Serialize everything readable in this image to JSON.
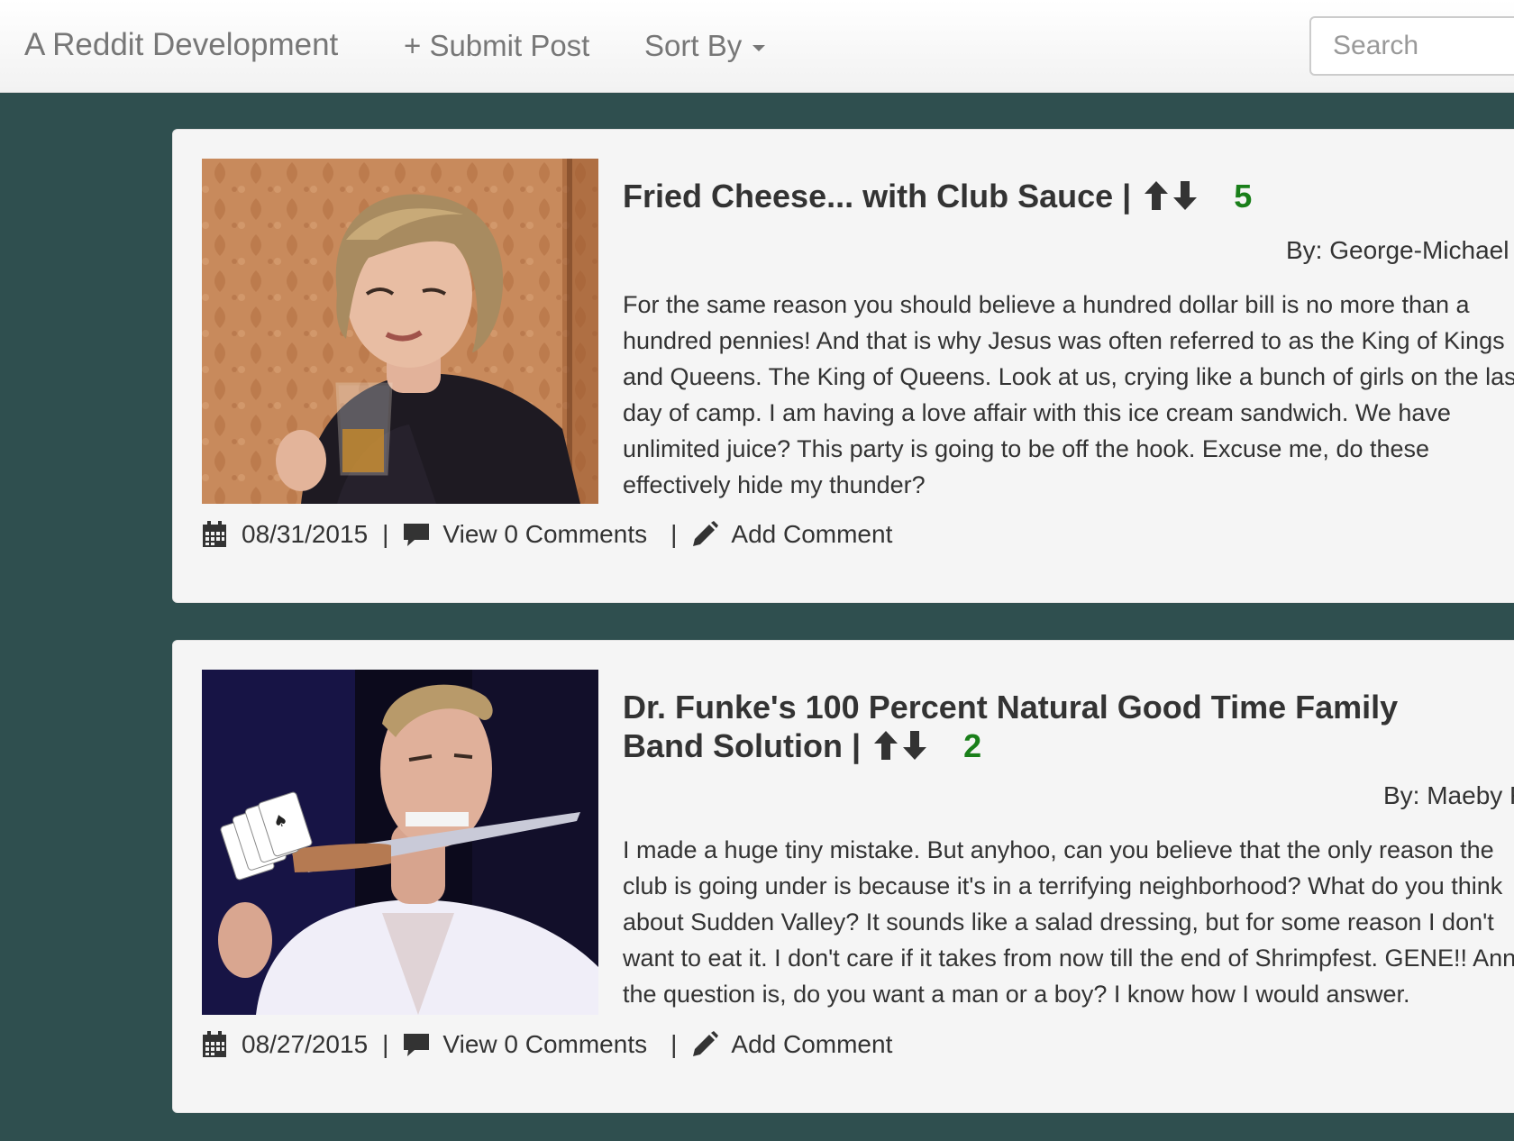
{
  "navbar": {
    "brand": "A Reddit Development",
    "submit_label": "+ Submit Post",
    "sort_label": "Sort By",
    "search_placeholder": "Search"
  },
  "posts": [
    {
      "title": "Fried Cheese... with Club Sauce |",
      "score": "5",
      "author": "By: George-Michael",
      "body": "For the same reason you should believe a hundred dollar bill is no more than a hundred pennies! And that is why Jesus was often referred to as the King of Kings and Queens. The King of Queens. Look at us, crying like a bunch of girls on the last day of camp. I am having a love affair with this ice cream sandwich. We have unlimited juice? This party is going to be off the hook. Excuse me, do these effectively hide my thunder?",
      "date": "08/31/2015",
      "comments_label": "View 0 Comments",
      "add_comment_label": "Add Comment"
    },
    {
      "title": "Dr. Funke's 100 Percent Natural Good Time Family Band Solution |",
      "score": "2",
      "author": "By: Maeby Funke",
      "body": "I made a huge tiny mistake. But anyhoo, can you believe that the only reason the club is going under is because it's in a terrifying neighborhood? What do you think about Sudden Valley? It sounds like a salad dressing, but for some reason I don't want to eat it. I don't care if it takes from now till the end of Shrimpfest. GENE!! Ann, the question is, do you want a man or a boy? I know how I would answer.",
      "date": "08/27/2015",
      "comments_label": "View 0 Comments",
      "add_comment_label": "Add Comment"
    }
  ],
  "colors": {
    "background": "#2f4f4f",
    "score": "#1a7f1a",
    "card": "#f5f5f5"
  },
  "icons": [
    "calendar-icon",
    "comment-icon",
    "pencil-icon",
    "arrow-up-icon",
    "arrow-down-icon",
    "caret-down-icon"
  ]
}
